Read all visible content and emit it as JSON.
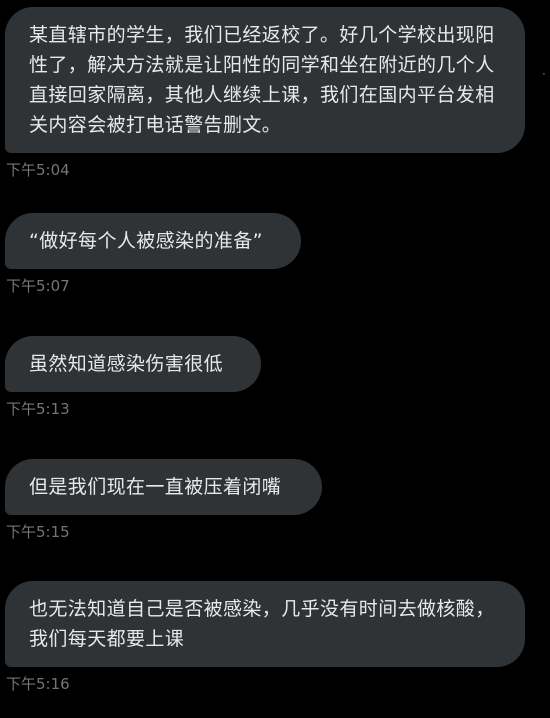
{
  "messages": [
    {
      "text": "某直辖市的学生，我们已经返校了。好几个学校出现阳性了，解决方法就是让阳性的同学和坐在附近的几个人直接回家隔离，其他人继续上课，我们在国内平台发相关内容会被打电话警告删文。",
      "time": "下午5:04"
    },
    {
      "text": "“做好每个人被感染的准备”",
      "time": "下午5:07"
    },
    {
      "text": "虽然知道感染伤害很低",
      "time": "下午5:13"
    },
    {
      "text": "但是我们现在一直被压着闭嘴",
      "time": "下午5:15"
    },
    {
      "text": "也无法知道自己是否被感染，几乎没有时间去做核酸，我们每天都要上课",
      "time": "下午5:16"
    }
  ],
  "colors": {
    "background": "#000000",
    "bubble": "#2f3336",
    "text": "#e7e9ea",
    "timestamp": "#71767b"
  }
}
